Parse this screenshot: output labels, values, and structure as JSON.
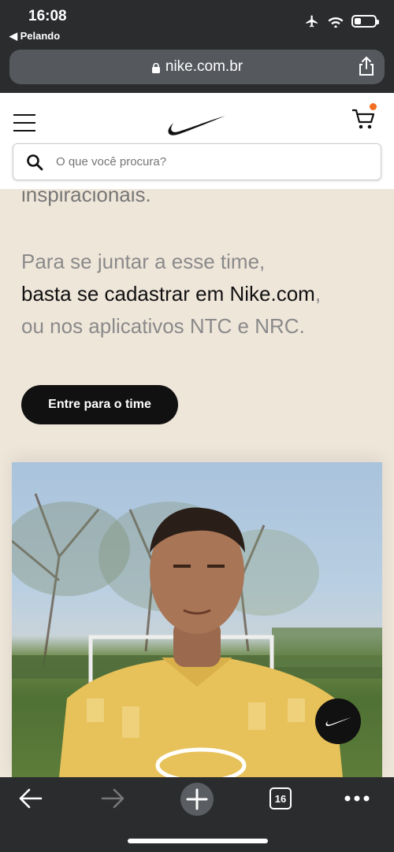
{
  "status": {
    "time": "16:08",
    "back_label": "◀ Pelando"
  },
  "browser": {
    "url": "nike.com.br",
    "tab_count": "16"
  },
  "header": {
    "search_placeholder": "O que você procura?"
  },
  "content": {
    "cut_text": "inspiracionais.",
    "para_line1": "Para se juntar a esse time,",
    "para_line2_dark": "basta se cadastrar em Nike.com",
    "para_line2_tail": ",",
    "para_line3": "ou nos aplicativos NTC e NRC.",
    "cta_label": "Entre para o time"
  },
  "colors": {
    "page_bg": "#efe6da",
    "cart_badge": "#f36f21",
    "button_bg": "#111111"
  }
}
